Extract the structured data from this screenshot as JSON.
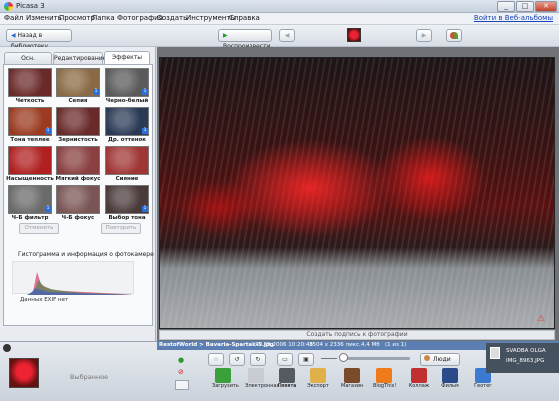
{
  "window": {
    "title": "Picasa 3",
    "minimize": "_",
    "maximize": "□",
    "close": "✕"
  },
  "menu": [
    "Файл",
    "Изменить",
    "Просмотр",
    "Папка",
    "Фотография",
    "Создать",
    "Инструменты",
    "Справка"
  ],
  "login_link": "Войти в Веб-альбомы",
  "toolbar": {
    "back_label": "Назад в библиотеку",
    "play_label": "Воспроизвести",
    "back_arrow": "◀",
    "play_arrow": "▶",
    "prev_icon": "◀",
    "next_icon": "▶"
  },
  "tabs": [
    {
      "label": "Осн. операции",
      "active": false
    },
    {
      "label": "Редактирование",
      "active": false
    },
    {
      "label": "Эффекты",
      "active": true
    }
  ],
  "effects": [
    {
      "label": "Четкость",
      "color": "#6b2a2a",
      "badge": ""
    },
    {
      "label": "Сепия",
      "color": "#8a6a45",
      "badge": "1"
    },
    {
      "label": "Черно-белый",
      "color": "#5a5a5a",
      "badge": "1"
    },
    {
      "label": "Тона теплее",
      "color": "#9a3a20",
      "badge": "1"
    },
    {
      "label": "Зернистость",
      "color": "#6a2a2a",
      "badge": ""
    },
    {
      "label": "Др. оттенок",
      "color": "#2a3a55",
      "badge": "1"
    },
    {
      "label": "Насыщенность",
      "color": "#b02020",
      "badge": ""
    },
    {
      "label": "Мягкий фокус",
      "color": "#8a4040",
      "badge": ""
    },
    {
      "label": "Сияние",
      "color": "#a03535",
      "badge": ""
    },
    {
      "label": "Ч-Б фильтр",
      "color": "#6a6a6a",
      "badge": "1"
    },
    {
      "label": "Ч-Б фокус",
      "color": "#7a5555",
      "badge": ""
    },
    {
      "label": "Выбор тона",
      "color": "#4a3a3a",
      "badge": "1"
    }
  ],
  "panel_buttons": {
    "undo": "Отменить",
    "redo": "Повторить"
  },
  "histogram": {
    "title": "Гистограмма и информация о фотокамере",
    "exif": "Данных EXIF нет"
  },
  "caption_placeholder": "Создать подпись к фотографии",
  "status": {
    "path": "RestofWorld > Bavaria-Spartak-5.jpg",
    "date": "30.09.2006 10:20:48",
    "dims": "3504 x 2336 пикс.",
    "size": "4,4 Мб",
    "count": "(1 из 1)"
  },
  "tray": {
    "label": "Выбранное",
    "people_label": "Люди"
  },
  "actions": [
    {
      "label": "Загрузить",
      "color": "#3aa03a",
      "icon": "upload-icon"
    },
    {
      "label": "Электронная почта",
      "color": "#c8ccd2",
      "icon": "email-icon"
    },
    {
      "label": "Печать",
      "color": "#555a60",
      "icon": "printer-icon"
    },
    {
      "label": "Экспорт",
      "color": "#e0b04a",
      "icon": "folder-icon"
    },
    {
      "label": "Магазин",
      "color": "#7a4a2a",
      "icon": "shop-icon"
    },
    {
      "label": "BlogThis!",
      "color": "#ef7a1a",
      "icon": "blogger-icon"
    },
    {
      "label": "Коллаж",
      "color": "#c03030",
      "icon": "collage-icon"
    },
    {
      "label": "Фильм",
      "color": "#2a4a8a",
      "icon": "movie-icon"
    },
    {
      "label": "Геотег",
      "color": "#3a7ad0",
      "icon": "geotag-icon"
    }
  ],
  "user": {
    "name": "SVADBA OLGA",
    "file": "IMG_8963.JPG"
  }
}
